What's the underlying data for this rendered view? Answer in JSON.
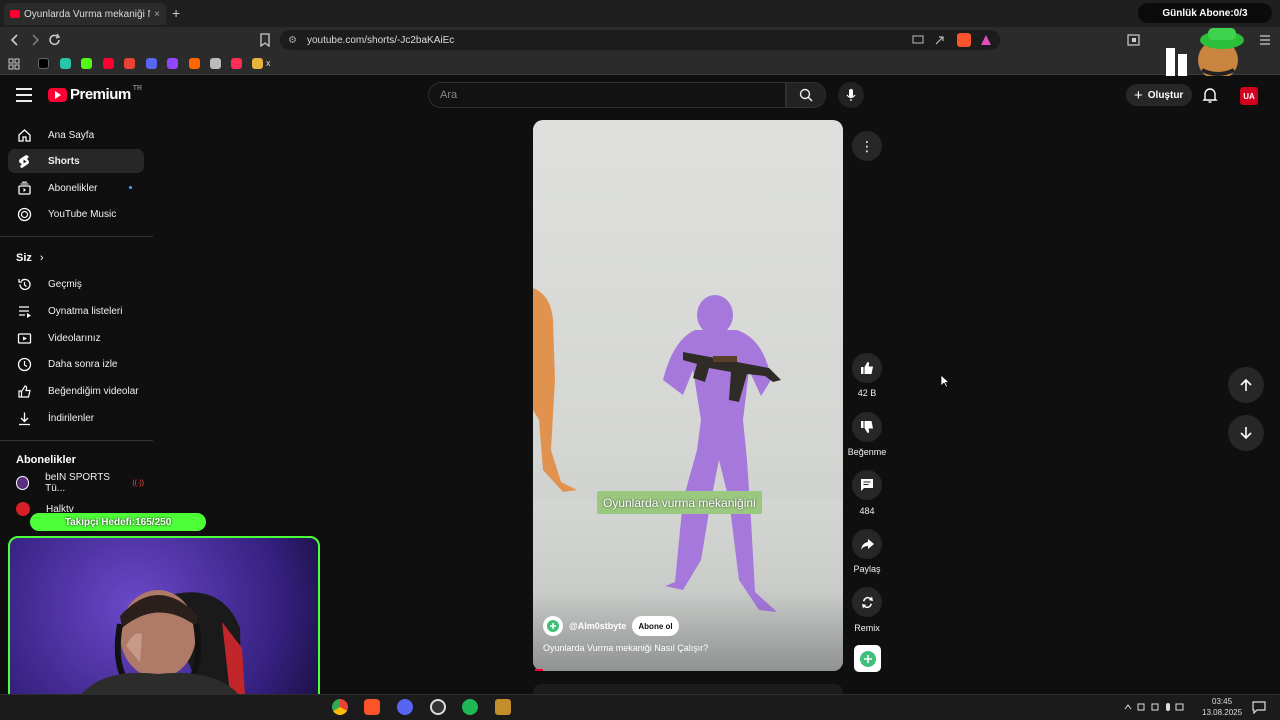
{
  "browser": {
    "tab_title": "Oyunlarda Vurma mekaniği Nasıl",
    "tab_close": "×",
    "new_tab": "+",
    "url": "youtube.com/shorts/-Jc2baKAiEc",
    "bookmark_folder": "x"
  },
  "overlay": {
    "abone_counter": "Günlük Abone:0/3",
    "follower_goal": "Takipçi Hedefi:165/250"
  },
  "header": {
    "logo_text": "Premium",
    "logo_region": "TR",
    "search_placeholder": "Ara",
    "create_label": "Oluştur",
    "account_initials": "UA"
  },
  "sidebar": {
    "main_items": [
      {
        "label": "Ana Sayfa",
        "icon": "home-icon"
      },
      {
        "label": "Shorts",
        "icon": "shorts-icon",
        "active": true
      },
      {
        "label": "Abonelikler",
        "icon": "subscriptions-icon"
      },
      {
        "label": "YouTube Music",
        "icon": "music-icon"
      }
    ],
    "you_heading": "Siz",
    "you_items": [
      {
        "label": "Geçmiş",
        "icon": "history-icon"
      },
      {
        "label": "Oynatma listeleri",
        "icon": "playlist-icon"
      },
      {
        "label": "Videolarınız",
        "icon": "videos-icon"
      },
      {
        "label": "Daha sonra izle",
        "icon": "clock-icon"
      },
      {
        "label": "Beğendiğim videolar",
        "icon": "thumb-up-icon"
      },
      {
        "label": "İndirilenler",
        "icon": "download-icon"
      }
    ],
    "subs_heading": "Abonelikler",
    "subs_items": [
      {
        "label": "beIN SPORTS Tü...",
        "color": "#5a2d82"
      },
      {
        "label": "Halktv",
        "color": "#d61f26"
      }
    ]
  },
  "short": {
    "caption": "Oyunlarda vurma mekaniğini",
    "channel": "@Alm0stbyte",
    "subscribe_label": "Abone ol",
    "title": "Oyunlarda Vurma mekaniği Nasıl Çalışır?"
  },
  "actions": {
    "likes": "42 B",
    "dislike_label": "Beğenme",
    "comments": "484",
    "share_label": "Paylaş",
    "remix_label": "Remix"
  },
  "system": {
    "time": "03:45",
    "date": "13.08.2025"
  },
  "colors": {
    "accent": "#ff0033",
    "overlay_green": "#4dff36"
  }
}
